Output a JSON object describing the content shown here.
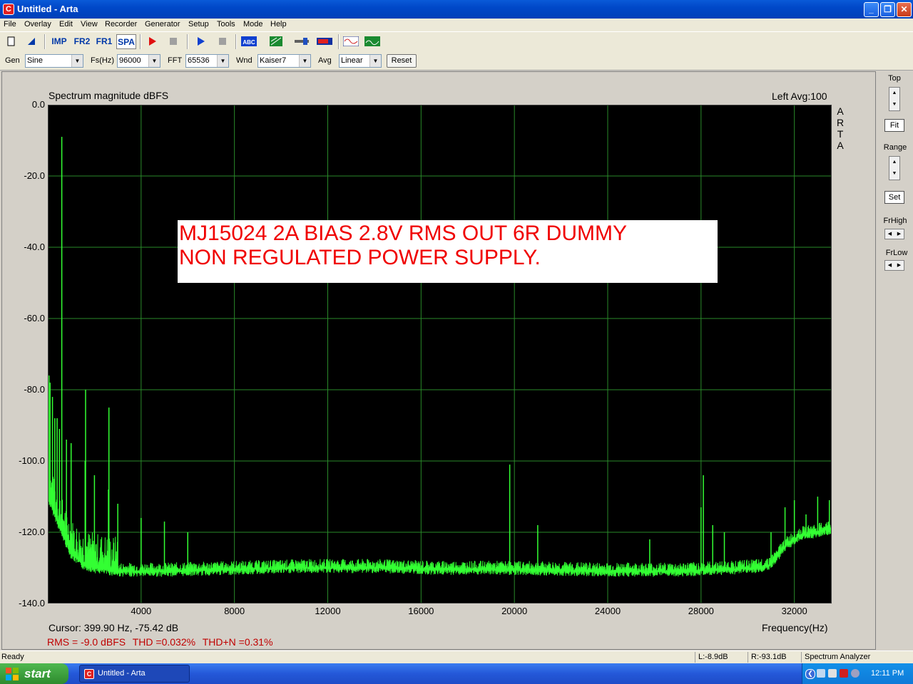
{
  "window": {
    "title": "Untitled - Arta",
    "app_icon": "arta-app-icon",
    "min": "_",
    "max": "❐",
    "close": "✕"
  },
  "menu": [
    "File",
    "Overlay",
    "Edit",
    "View",
    "Recorder",
    "Generator",
    "Setup",
    "Tools",
    "Mode",
    "Help"
  ],
  "toolbar": {
    "imp": "IMP",
    "fr2": "FR2",
    "fr1": "FR1",
    "spa": "SPA",
    "icons": [
      "new-file-icon",
      "open-file-icon",
      "record-icon",
      "stop-icon",
      "play-icon",
      "stop-icon",
      "abc-icon",
      "meter-icon",
      "slider-icon",
      "level-icon",
      "scope-icon",
      "monitor-icon"
    ]
  },
  "controls": {
    "gen_label": "Gen",
    "gen_value": "Sine",
    "fs_label": "Fs(Hz)",
    "fs_value": "96000",
    "fft_label": "FFT",
    "fft_value": "65536",
    "wnd_label": "Wnd",
    "wnd_value": "Kaiser7",
    "avg_label": "Avg",
    "avg_value": "Linear",
    "reset": "Reset"
  },
  "plot": {
    "title": "Spectrum magnitude dBFS",
    "info": "Left  Avg:100",
    "watermark": "ARTA",
    "cursor": "Cursor: 399.90 Hz, -75.42 dB",
    "x_axis_label": "Frequency(Hz)",
    "measurement": {
      "rms": "RMS =   -9.0 dBFS",
      "thd": "THD =0.032%",
      "thdn": "THD+N =0.31%"
    },
    "annotation_line1": "MJ15024 2A BIAS 2.8V RMS OUT 6R DUMMY",
    "annotation_line2": "NON REGULATED POWER SUPPLY."
  },
  "chart_data": {
    "type": "line",
    "title": "Spectrum magnitude dBFS",
    "xlabel": "Frequency(Hz)",
    "ylabel": "",
    "xlim": [
      0,
      33600
    ],
    "ylim": [
      -140,
      0
    ],
    "x_ticks": [
      4000,
      8000,
      12000,
      16000,
      20000,
      24000,
      28000,
      32000
    ],
    "x_tick_labels": [
      "4000",
      "8000",
      "12000",
      "16000",
      "20000",
      "24000",
      "28000",
      "32000"
    ],
    "y_ticks": [
      0,
      -20,
      -40,
      -60,
      -80,
      -100,
      -120,
      -140
    ],
    "y_tick_labels": [
      "0.0",
      "-20.0",
      "-40.0",
      "-60.0",
      "-80.0",
      "-100.0",
      "-120.0",
      "-140.0"
    ],
    "grid": true,
    "background": "#000000",
    "grid_color": "#2a8a2a",
    "line_color": "#33ff33",
    "series": [
      {
        "floor": [
          [
            0,
            -110
          ],
          [
            300,
            -115
          ],
          [
            600,
            -120
          ],
          [
            1000,
            -126
          ],
          [
            1500,
            -129
          ],
          [
            2000,
            -130
          ],
          [
            3000,
            -131
          ],
          [
            5000,
            -131
          ],
          [
            8000,
            -130.5
          ],
          [
            11000,
            -130
          ],
          [
            14000,
            -130
          ],
          [
            17000,
            -130.5
          ],
          [
            20000,
            -130.5
          ],
          [
            24000,
            -131
          ],
          [
            27000,
            -131
          ],
          [
            29000,
            -130.5
          ],
          [
            30500,
            -130
          ],
          [
            31000,
            -129
          ],
          [
            31600,
            -124
          ],
          [
            32200,
            -121
          ],
          [
            33000,
            -120
          ],
          [
            33600,
            -119
          ]
        ],
        "peaks": [
          [
            50,
            -76
          ],
          [
            100,
            -78
          ],
          [
            200,
            -82
          ],
          [
            300,
            -88
          ],
          [
            400,
            -88
          ],
          [
            500,
            -91
          ],
          [
            600,
            -9
          ],
          [
            800,
            -94
          ],
          [
            1000,
            -95
          ],
          [
            1600,
            -100
          ],
          [
            1620,
            -80
          ],
          [
            2000,
            -104
          ],
          [
            2600,
            -108
          ],
          [
            2620,
            -85
          ],
          [
            3000,
            -112
          ],
          [
            4000,
            -116
          ],
          [
            5000,
            -117
          ],
          [
            6000,
            -120
          ],
          [
            19800,
            -101
          ],
          [
            21000,
            -118
          ],
          [
            25800,
            -122
          ],
          [
            28000,
            -113
          ],
          [
            28100,
            -104
          ],
          [
            28500,
            -118
          ],
          [
            29000,
            -120
          ],
          [
            31000,
            -120
          ],
          [
            31600,
            -113
          ],
          [
            32000,
            -111
          ],
          [
            32500,
            -115
          ],
          [
            33000,
            -110
          ],
          [
            33500,
            -111
          ]
        ]
      }
    ]
  },
  "right_panel": {
    "top": "Top",
    "fit": "Fit",
    "range": "Range",
    "set": "Set",
    "frhigh": "FrHigh",
    "frlow": "FrLow"
  },
  "status": {
    "ready": "Ready",
    "left": "L:-8.9dB",
    "right": "R:-93.1dB",
    "mode": "Spectrum Analyzer"
  },
  "taskbar": {
    "start": "start",
    "task": "Untitled - Arta",
    "clock": "12:11 PM"
  }
}
